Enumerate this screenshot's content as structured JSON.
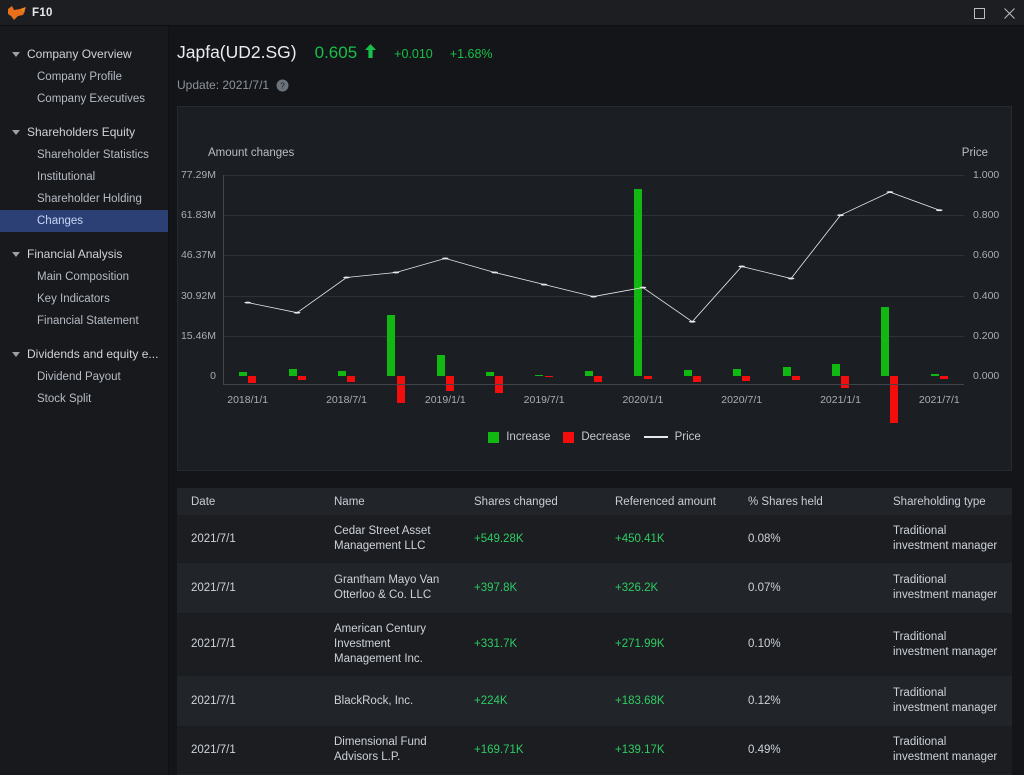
{
  "titlebar": {
    "app_name": "F10",
    "logo_icon": "bull-logo-icon",
    "maximize_icon": "maximize-icon",
    "close_icon": "close-icon"
  },
  "sidebar": {
    "groups": [
      {
        "label": "Company Overview",
        "items": [
          {
            "label": "Company Profile",
            "selected": false
          },
          {
            "label": "Company Executives",
            "selected": false
          }
        ]
      },
      {
        "label": "Shareholders Equity",
        "items": [
          {
            "label": "Shareholder Statistics",
            "selected": false
          },
          {
            "label": "Institutional",
            "selected": false
          },
          {
            "label": "Shareholder Holding",
            "selected": false
          },
          {
            "label": "Changes",
            "selected": true
          }
        ]
      },
      {
        "label": "Financial Analysis",
        "items": [
          {
            "label": "Main Composition",
            "selected": false
          },
          {
            "label": "Key Indicators",
            "selected": false
          },
          {
            "label": "Financial Statement",
            "selected": false
          }
        ]
      },
      {
        "label": "Dividends and equity e...",
        "items": [
          {
            "label": "Dividend Payout",
            "selected": false
          },
          {
            "label": "Stock Split",
            "selected": false
          }
        ]
      }
    ]
  },
  "header": {
    "stock_name": "Japfa(UD2.SG)",
    "price": "0.605",
    "direction_icon": "arrow-up-icon",
    "change": "+0.010",
    "change_pct": "+1.68%",
    "update_text": "Update: 2021/7/1",
    "help_icon": "help-circle-icon",
    "up_color": "#18c04a"
  },
  "chart_data": {
    "type": "bar",
    "title": "",
    "left_axis_title": "Amount changes",
    "right_axis_title": "Price",
    "xlabel": "",
    "ylabel": "Amount changes",
    "grid": true,
    "legend_position": "bottom",
    "colors": {
      "increase": "#12b812",
      "decrease": "#f40d0d",
      "price": "#e6e8ea"
    },
    "ylim": [
      -3.5,
      77.29
    ],
    "yticks": [
      "0",
      "15.46M",
      "30.92M",
      "46.37M",
      "61.83M",
      "77.29M"
    ],
    "ytick_values": [
      0,
      15.46,
      30.92,
      46.37,
      61.83,
      77.29
    ],
    "y2lim": [
      -0.045,
      1.0
    ],
    "y2ticks": [
      "0.000",
      "0.200",
      "0.400",
      "0.600",
      "0.800",
      "1.000"
    ],
    "y2tick_values": [
      0.0,
      0.2,
      0.4,
      0.6,
      0.8,
      1.0
    ],
    "x": [
      "2018/1/1",
      "2018/4/1",
      "2018/7/1",
      "2018/10/1",
      "2019/1/1",
      "2019/4/1",
      "2019/7/1",
      "2019/10/1",
      "2020/1/1",
      "2020/4/1",
      "2020/7/1",
      "2020/10/1",
      "2021/1/1",
      "2021/4/1",
      "2021/7/1"
    ],
    "xticks_shown": [
      "2018/1/1",
      "2018/7/1",
      "2019/1/1",
      "2019/7/1",
      "2020/1/1",
      "2020/7/1",
      "2021/1/1",
      "2021/7/1"
    ],
    "series": [
      {
        "name": "Increase",
        "type": "bar",
        "axis": "left",
        "values": [
          1.5,
          2.5,
          1.8,
          23.5,
          8.0,
          1.5,
          0.5,
          2.0,
          72.0,
          2.2,
          2.5,
          3.5,
          4.5,
          26.5,
          0.6
        ]
      },
      {
        "name": "Decrease",
        "type": "bar",
        "axis": "left",
        "values": [
          -2.6,
          -1.4,
          -2.2,
          -10.5,
          -6.0,
          -6.5,
          -0.4,
          -2.2,
          -1.2,
          -2.5,
          -2.0,
          -1.5,
          -4.5,
          -18.0,
          -1.2
        ]
      },
      {
        "name": "Price",
        "type": "line",
        "axis": "right",
        "values": [
          0.365,
          0.315,
          0.49,
          0.515,
          0.585,
          0.515,
          0.455,
          0.395,
          0.44,
          0.27,
          0.545,
          0.485,
          0.8,
          0.915,
          0.825
        ]
      }
    ],
    "legend": [
      {
        "label": "Increase",
        "swatch": "#12b812",
        "kind": "square"
      },
      {
        "label": "Decrease",
        "swatch": "#f40d0d",
        "kind": "square"
      },
      {
        "label": "Price",
        "swatch": "#e6e8ea",
        "kind": "line"
      }
    ]
  },
  "table": {
    "columns": [
      "Date",
      "Name",
      "Shares changed",
      "Referenced amount",
      "% Shares held",
      "Shareholding type"
    ],
    "rows": [
      {
        "date": "2021/7/1",
        "name": "Cedar Street Asset Management LLC",
        "shares": "+549.28K",
        "ref": "+450.41K",
        "pct": "0.08%",
        "type": "Traditional investment manager"
      },
      {
        "date": "2021/7/1",
        "name": "Grantham Mayo Van Otterloo & Co. LLC",
        "shares": "+397.8K",
        "ref": "+326.2K",
        "pct": "0.07%",
        "type": "Traditional investment manager"
      },
      {
        "date": "2021/7/1",
        "name": "American Century Investment Management Inc.",
        "shares": "+331.7K",
        "ref": "+271.99K",
        "pct": "0.10%",
        "type": "Traditional investment manager"
      },
      {
        "date": "2021/7/1",
        "name": "BlackRock, Inc.",
        "shares": "+224K",
        "ref": "+183.68K",
        "pct": "0.12%",
        "type": "Traditional investment manager"
      },
      {
        "date": "2021/7/1",
        "name": "Dimensional Fund Advisors L.P.",
        "shares": "+169.71K",
        "ref": "+139.17K",
        "pct": "0.49%",
        "type": "Traditional investment manager"
      }
    ]
  }
}
